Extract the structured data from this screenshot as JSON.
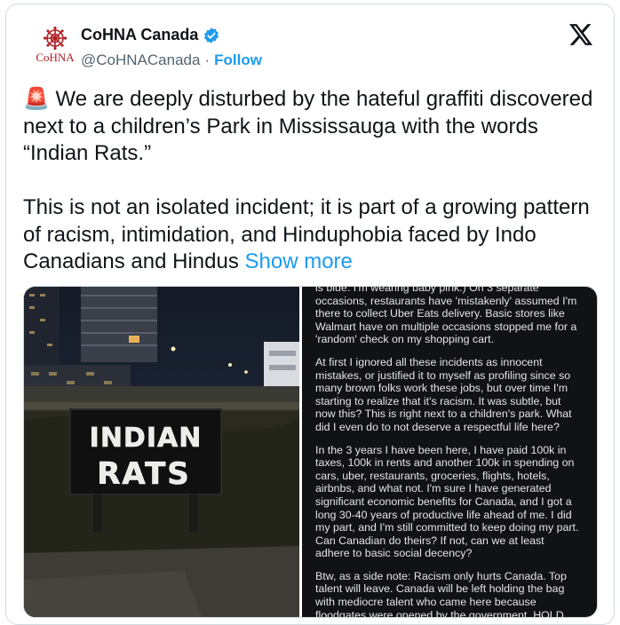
{
  "author": {
    "display_name": "CoHNA Canada",
    "handle": "@CoHNACanada",
    "separator": "·",
    "follow_label": "Follow",
    "avatar_text": "CoHNA"
  },
  "tweet": {
    "emoji": "🚨",
    "body": " We are deeply disturbed by the hateful graffiti discovered next to a children’s Park in Mississauga with the words “Indian Rats.”\n\nThis is not an isolated incident; it is part of a growing pattern of racism, intimidation, and Hinduphobia faced by Indo Canadians and Hindus ",
    "show_more_label": "Show more"
  },
  "media": {
    "photo_graffiti": [
      "INDIAN",
      "RATS"
    ],
    "screenshot_paragraphs": [
      "is blue. I'm wearing baby pink.) On 3 separate occasions, restaurants have 'mistakenly' assumed I'm there to collect Uber Eats delivery. Basic stores like Walmart have on multiple occasions stopped me for a 'random' check on my shopping cart.",
      "At first I ignored all these incidents as innocent mistakes, or justified it to myself as profiling since so many brown folks work these jobs, but over time I'm starting to realize that it's racism. It was subtle, but now this? This is right next to a children's park. What did I even do to not deserve a respectful life here?",
      "In the 3 years I have been here, I have paid 100k in taxes, 100k in rents and another 100k in spending on cars, uber, restaurants, groceries, flights, hotels, airbnbs, and what not. I'm sure I have generated significant economic benefits for Canada, and I got a long 30-40 years of productive life ahead of me. I did my part, and I'm still committed to keep doing my part. Can Canadian do theirs? If not, can we at least adhere to basic social decency?",
      "Btw, as a side note: Racism only hurts Canada. Top talent will leave. Canada will be left holding the bag with mediocre talent who came here because floodgates were opened by the government. HOLD"
    ]
  },
  "colors": {
    "accent": "#1d9bf0",
    "verified": "#1d9bf0",
    "text_primary": "#0f1419",
    "text_secondary": "#536471",
    "logo_red": "#b01e22"
  },
  "icons": {
    "verified": "verified-badge-icon",
    "x_logo": "x-logo-icon"
  }
}
